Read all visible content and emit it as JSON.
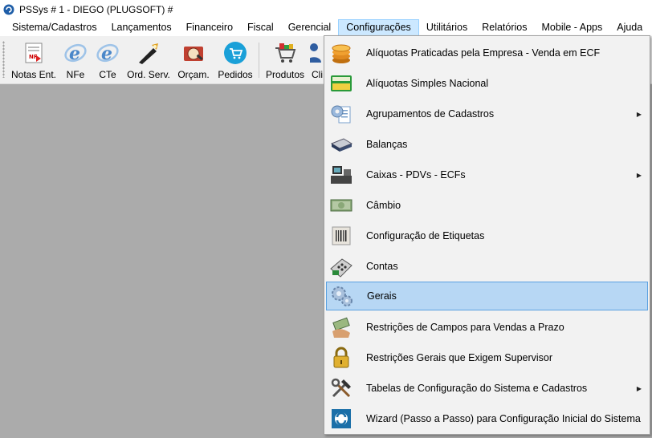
{
  "window": {
    "title": "PSSys # 1 - DIEGO (PLUGSOFT) #"
  },
  "menubar": {
    "items": [
      {
        "label": "Sistema/Cadastros"
      },
      {
        "label": "Lançamentos"
      },
      {
        "label": "Financeiro"
      },
      {
        "label": "Fiscal"
      },
      {
        "label": "Gerencial"
      },
      {
        "label": "Configurações",
        "active": true
      },
      {
        "label": "Utilitários"
      },
      {
        "label": "Relatórios"
      },
      {
        "label": "Mobile - Apps"
      },
      {
        "label": "Ajuda"
      }
    ]
  },
  "toolbar": {
    "buttons": [
      {
        "label": "Notas Ent.",
        "icon": "invoice-entry-icon"
      },
      {
        "label": "NFe",
        "icon": "nfe-e-icon"
      },
      {
        "label": "CTe",
        "icon": "cte-e-icon"
      },
      {
        "label": "Ord. Serv.",
        "icon": "service-order-icon"
      },
      {
        "label": "Orçam.",
        "icon": "budget-icon"
      },
      {
        "label": "Pedidos",
        "icon": "orders-cart-icon"
      },
      {
        "label": "Produtos",
        "icon": "products-cart-icon"
      },
      {
        "label": "Cli",
        "icon": "clients-icon"
      }
    ]
  },
  "dropdown": {
    "items": [
      {
        "label": "Alíquotas Praticadas pela Empresa - Venda em ECF",
        "icon": "coins-icon",
        "submenu": false
      },
      {
        "label": "Alíquotas Simples Nacional",
        "icon": "simples-card-icon",
        "submenu": false
      },
      {
        "label": "Agrupamentos de Cadastros",
        "icon": "gear-document-icon",
        "submenu": true
      },
      {
        "label": "Balanças",
        "icon": "scale-icon",
        "submenu": false
      },
      {
        "label": "Caixas - PDVs - ECFs",
        "icon": "pos-terminal-icon",
        "submenu": true
      },
      {
        "label": "Câmbio",
        "icon": "money-bills-icon",
        "submenu": false
      },
      {
        "label": "Configuração de Etiquetas",
        "icon": "barcode-label-icon",
        "submenu": false
      },
      {
        "label": "Contas",
        "icon": "calculator-icon",
        "submenu": false
      },
      {
        "label": "Gerais",
        "icon": "gears-icon",
        "submenu": false,
        "hovered": true
      },
      {
        "label": "Restrições de Campos para Vendas a Prazo",
        "icon": "hand-money-icon",
        "submenu": false
      },
      {
        "label": "Restrições Gerais que Exigem Supervisor",
        "icon": "padlock-icon",
        "submenu": false
      },
      {
        "label": "Tabelas de Configuração do Sistema e Cadastros",
        "icon": "hammer-wrench-icon",
        "submenu": true
      },
      {
        "label": "Wizard (Passo a Passo) para Configuração Inicial do Sistema",
        "icon": "wizard-logo-icon",
        "submenu": false
      }
    ]
  },
  "colors": {
    "menu_active_bg": "#cce8ff",
    "dropdown_hover_bg": "#b7d7f4",
    "workspace_bg": "#ababab"
  }
}
